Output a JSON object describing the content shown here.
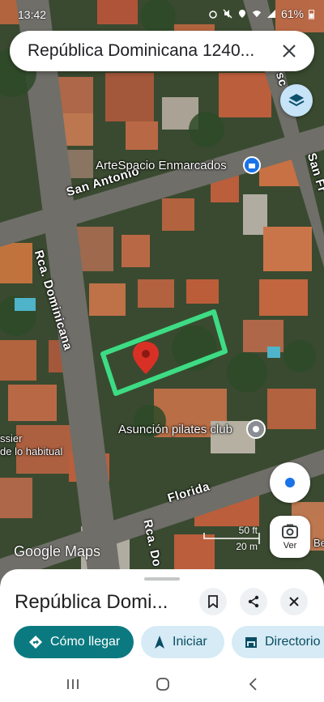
{
  "status_bar": {
    "time": "13:42",
    "battery": "61%"
  },
  "search": {
    "query": "República Dominicana 1240..."
  },
  "map": {
    "road_labels": {
      "san_antonio": "San Antonio",
      "rca_dominicana": "Rca. Dominicana",
      "florida": "Florida",
      "san_fr": "San Fr",
      "rca_do_bottom": "Rca. Do",
      "sc": "sc"
    },
    "places": {
      "artespacio": "ArteSpacio Enmarcados",
      "pilates": "Asunción pilates club",
      "ssier": "ssier",
      "habitual": "de lo habitual",
      "be": "Be"
    },
    "attribution": "Google Maps",
    "scale": {
      "imperial": "50 ft",
      "metric": "20 m"
    },
    "ver_label": "Ver",
    "colors": {
      "highlight": "#3ddc84",
      "pin": "#d93025",
      "accent": "#1a73e8"
    }
  },
  "sheet": {
    "title": "República Domi...",
    "actions": {
      "directions": "Cómo llegar",
      "start": "Iniciar",
      "directory": "Directorio"
    },
    "colors": {
      "primary": "#0b7a80",
      "secondary": "#d6ebf5"
    }
  }
}
